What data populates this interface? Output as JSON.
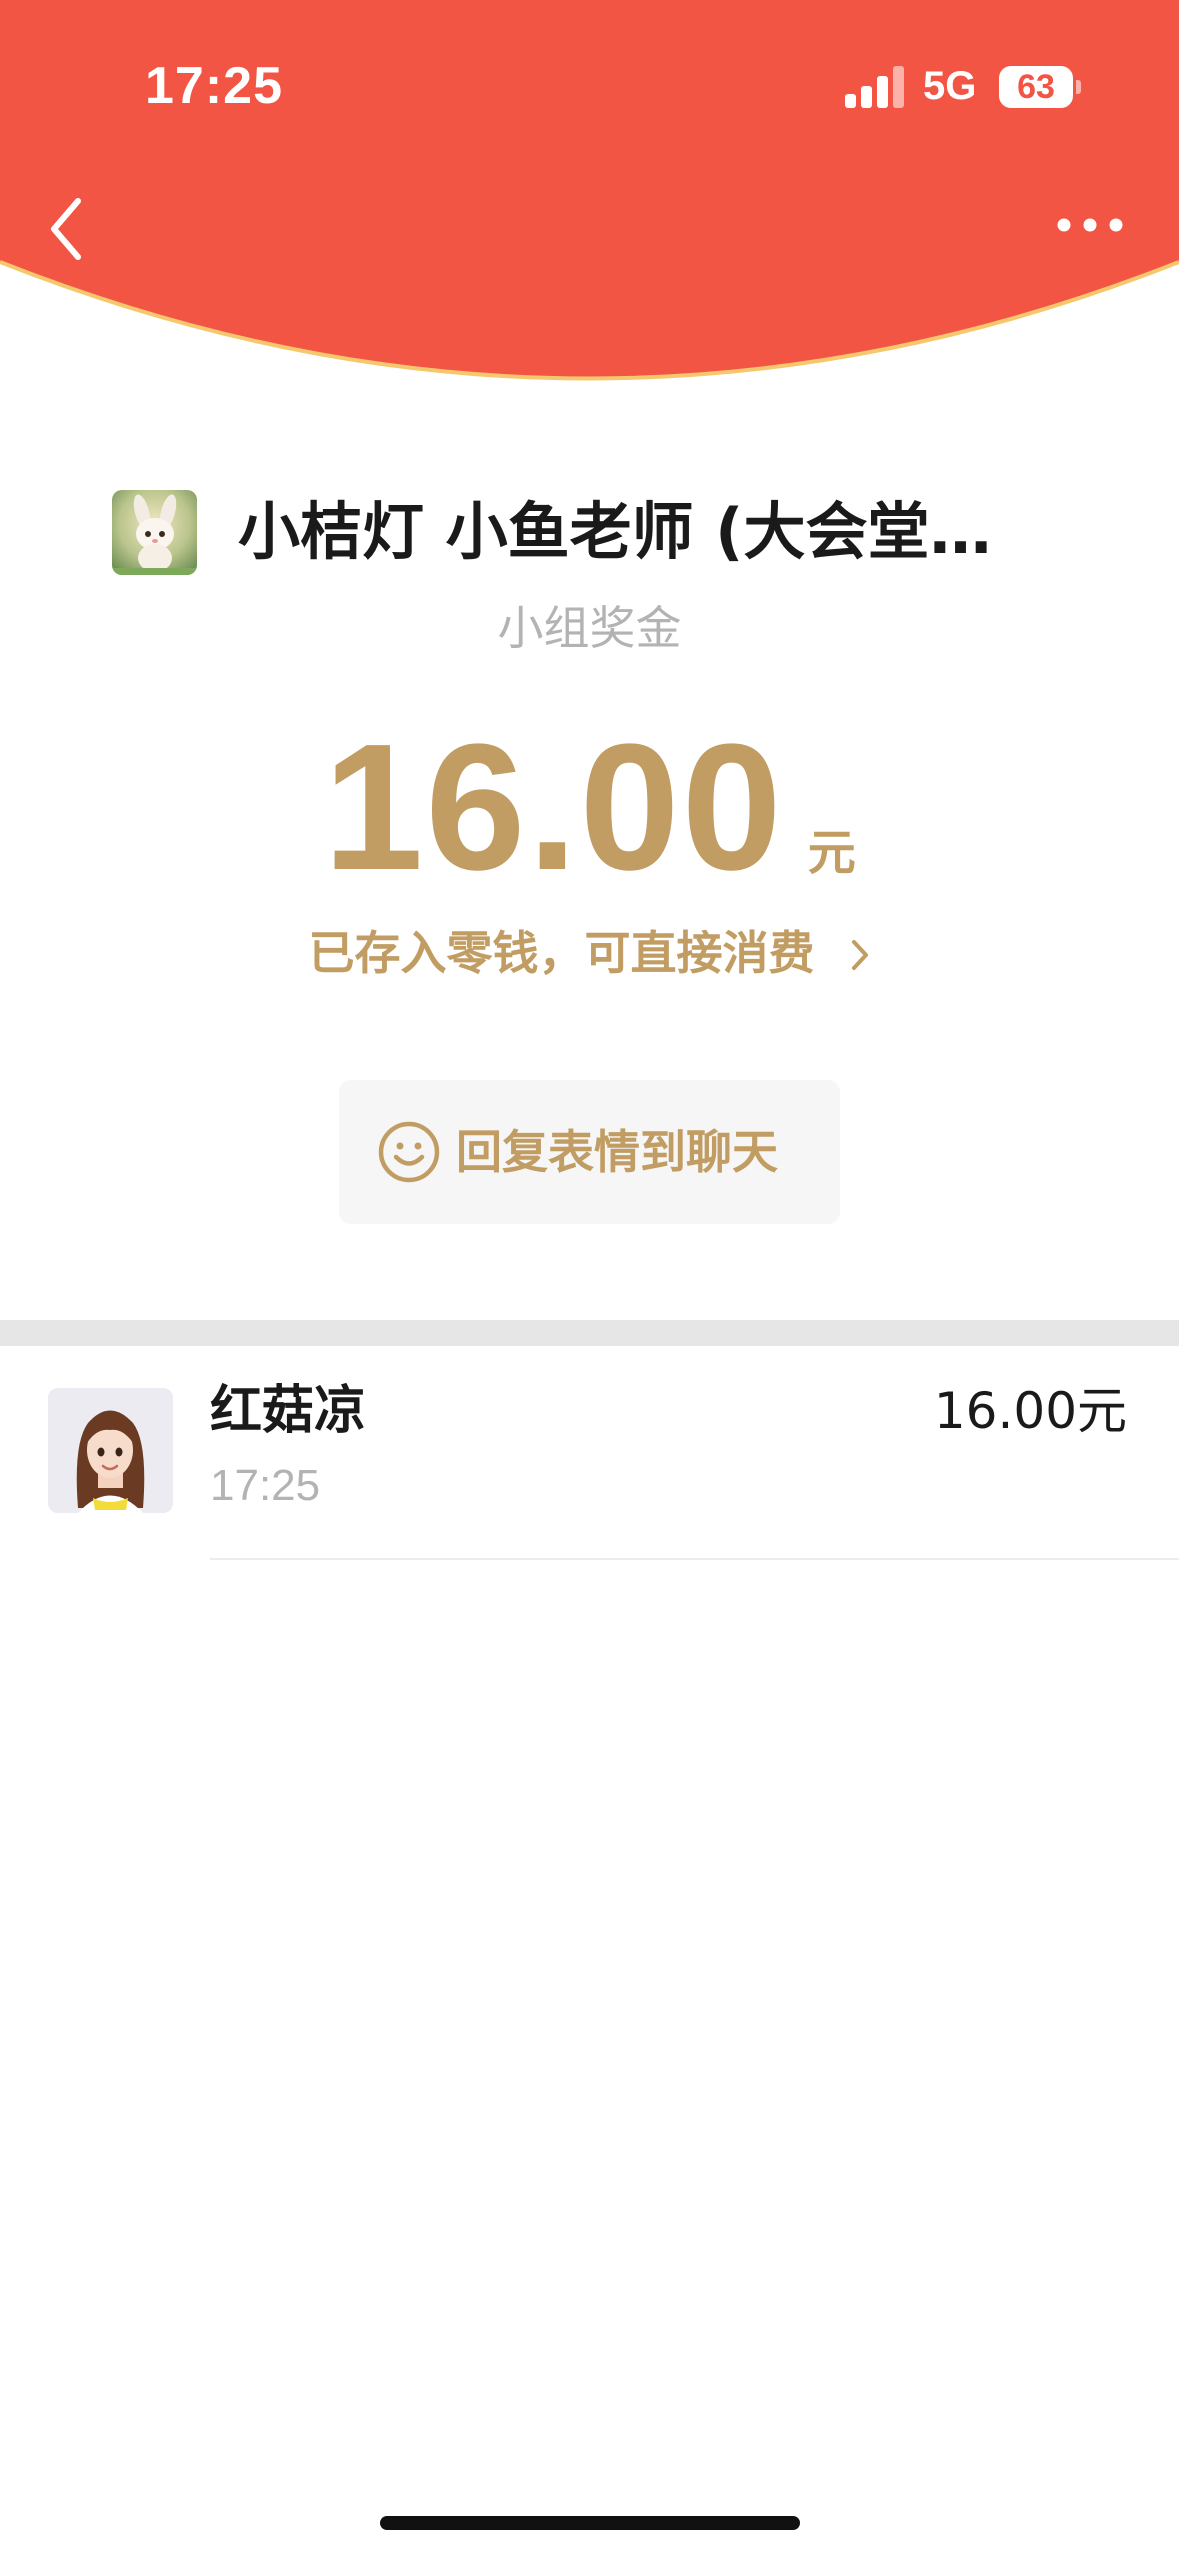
{
  "status_bar": {
    "time": "17:25",
    "network": "5G",
    "battery": "63"
  },
  "header": {
    "background_color": "#f35545",
    "curve_border_color": "#f6c86e"
  },
  "group": {
    "name": "小桔灯 小鱼老师 (大会堂…"
  },
  "subtitle": "小组奖金",
  "amount": {
    "value": "16.00",
    "unit": "元",
    "color": "#c19d64"
  },
  "stored_link": "已存入零钱，可直接消费",
  "reply_button": {
    "label": "回复表情到聊天"
  },
  "recipient": {
    "name": "红菇凉",
    "time": "17:25",
    "amount": "16.00元"
  }
}
